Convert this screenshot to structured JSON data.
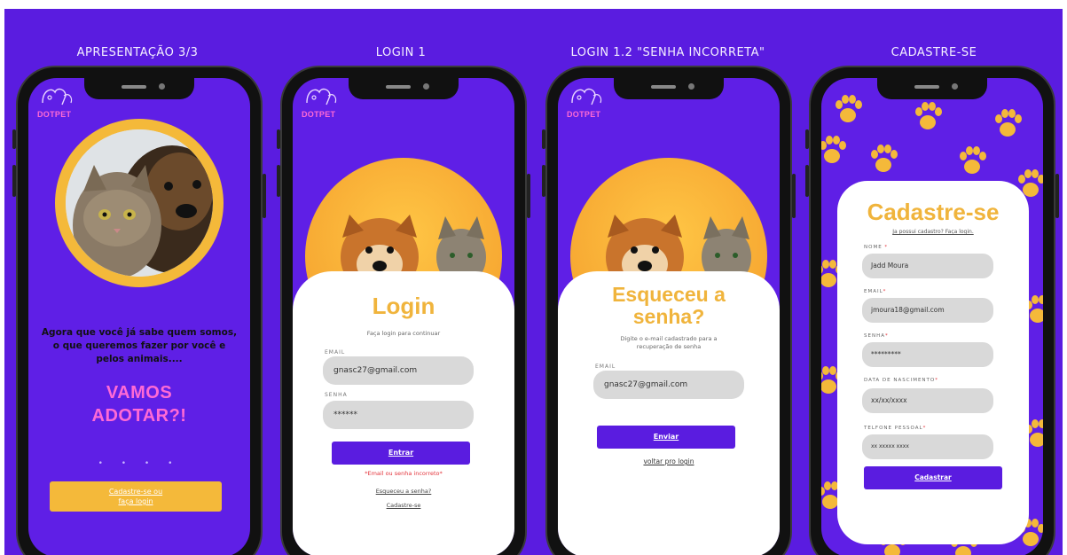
{
  "screens": [
    {
      "title": "APRESENTAÇÃO 3/3"
    },
    {
      "title": "LOGIN 1"
    },
    {
      "title": "LOGIN 1.2 \"SENHA INCORRETA\""
    },
    {
      "title": "CADASTRE-SE"
    }
  ],
  "brand": {
    "logo_text": "DOTPET",
    "primary": "#5a1ce0",
    "accent": "#f0b43c",
    "pink": "#ff6ad5"
  },
  "intro": {
    "text": "Agora que você já sabe quem somos, o que queremos fazer por você e pelos animais....",
    "headline_line1": "VAMOS",
    "headline_line2": "ADOTAR?!",
    "dots": "• • • •",
    "cta_line1": "Cadastre-se ou",
    "cta_line2": "faça login"
  },
  "login": {
    "title": "Login",
    "subtitle": "Faça login para continuar",
    "email_label": "EMAIL",
    "email_value": "gnasc27@gmail.com",
    "password_label": "SENHA",
    "password_value": "******",
    "submit_label": "Entrar",
    "error": "*Email ou senha incorreto*",
    "forgot_link": "Esqueceu a senha?",
    "signup_link": "Cadastre-se"
  },
  "forgot": {
    "title_line1": "Esqueceu a",
    "title_line2": "senha?",
    "subtitle_line1": "Digite o e-mail cadastrado para a",
    "subtitle_line2": "recuperação de senha",
    "email_label": "EMAIL",
    "email_value": "gnasc27@gmail.com",
    "submit_label": "Enviar",
    "back_link": "voltar pro login"
  },
  "register": {
    "title": "Cadastre-se",
    "login_link": "Ja possui cadastro? Faça login.",
    "name_label": "NOME",
    "name_value": "Jadd Moura",
    "email_label": "EMAIL",
    "email_value": "jmoura18@gmail.com",
    "password_label": "SENHA",
    "password_value": "*********",
    "birth_label": "DATA DE NASCIMENTO",
    "birth_placeholder": "xx/xx/xxxx",
    "phone_label": "TELFONE PESSOAL",
    "phone_placeholder": "xx xxxxx xxxx",
    "submit_label": "Cadastrar",
    "required_mark": "*"
  }
}
